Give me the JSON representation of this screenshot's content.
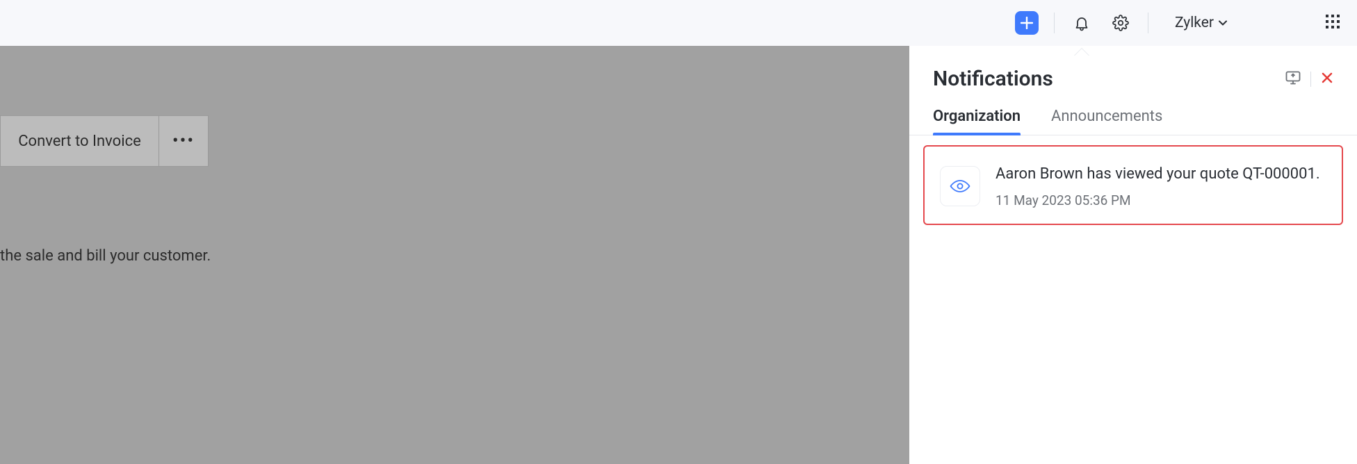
{
  "topbar": {
    "org_name": "Zylker"
  },
  "backdrop": {
    "convert_label": "Convert to Invoice",
    "more_label": "•••",
    "description_fragment": "the sale and bill your customer."
  },
  "notifications": {
    "title": "Notifications",
    "tabs": {
      "organization": "Organization",
      "announcements": "Announcements"
    },
    "items": [
      {
        "text": "Aaron Brown has viewed your quote QT-000001.",
        "time": "11 May 2023 05:36 PM"
      }
    ]
  }
}
